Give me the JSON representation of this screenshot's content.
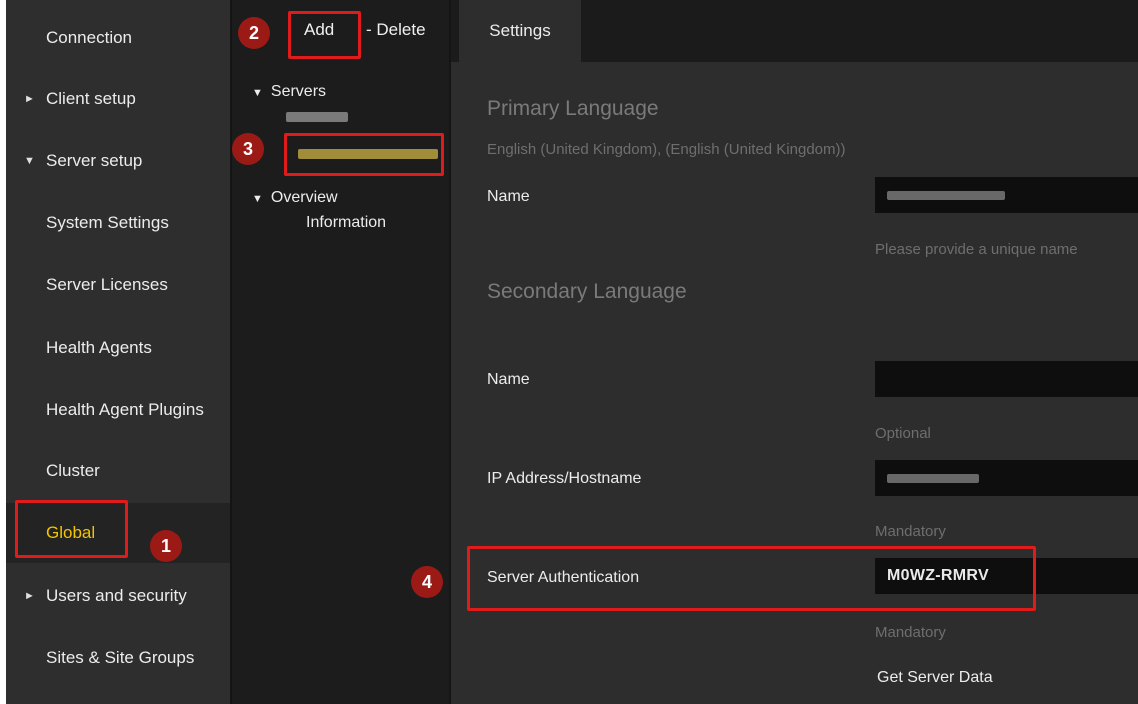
{
  "nav": {
    "items": [
      {
        "label": "Connection",
        "arrow": ""
      },
      {
        "label": "Client setup",
        "arrow": "►"
      },
      {
        "label": "Server setup",
        "arrow": "▼"
      },
      {
        "label": "System Settings",
        "arrow": ""
      },
      {
        "label": "Server Licenses",
        "arrow": ""
      },
      {
        "label": "Health Agents",
        "arrow": ""
      },
      {
        "label": "Health Agent Plugins",
        "arrow": ""
      },
      {
        "label": "Cluster",
        "arrow": ""
      },
      {
        "label": "Global",
        "arrow": ""
      },
      {
        "label": "Users and security",
        "arrow": "►"
      },
      {
        "label": "Sites & Site Groups",
        "arrow": ""
      }
    ],
    "selected": "Global",
    "selected_color": "#f4c400"
  },
  "toolbar": {
    "add_label": "Add",
    "delete_label": "- Delete"
  },
  "tree": {
    "servers_label": "Servers",
    "servers_arrow": "▼",
    "overview_label": "Overview",
    "overview_arrow": "▼",
    "information_label": "Information"
  },
  "tabs": {
    "settings_label": "Settings"
  },
  "settings": {
    "primary_language_title": "Primary Language",
    "primary_language_value": "English (United Kingdom), (English (United Kingdom))",
    "name_label": "Name",
    "name_hint": "Please provide a unique name",
    "secondary_language_title": "Secondary Language",
    "secondary_name_label": "Name",
    "secondary_name_hint": "Optional",
    "ip_label": "IP Address/Hostname",
    "ip_hint": "Mandatory",
    "auth_label": "Server Authentication",
    "auth_value": "M0WZ-RMRV",
    "auth_hint": "Mandatory",
    "get_server_data_label": "Get Server Data"
  },
  "annotations": {
    "badge_1": "1",
    "badge_2": "2",
    "badge_3": "3",
    "badge_4": "4",
    "highlight_color": "#e01b1b",
    "badge_color": "#9c1a16"
  }
}
